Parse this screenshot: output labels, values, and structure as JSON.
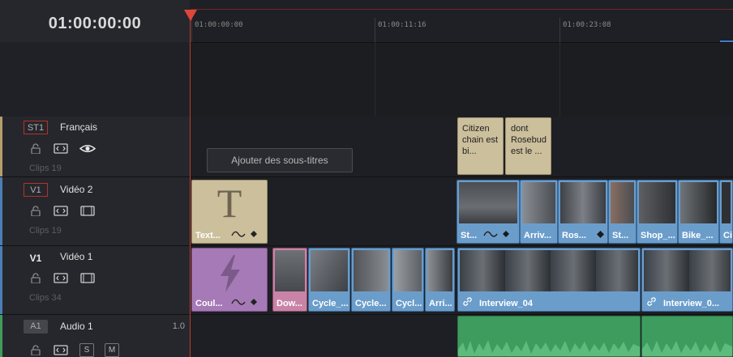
{
  "timecode": "01:00:00:00",
  "ruler": {
    "ticks": [
      "01:00:00:00",
      "01:00:11:16",
      "01:00:23:08"
    ]
  },
  "tracks": {
    "st1": {
      "badge": "ST1",
      "name": "Français",
      "clips": "Clips 19",
      "color": "#b59e6c"
    },
    "v2": {
      "badge": "V1",
      "name": "Vidéo 2",
      "clips": "Clips 19",
      "color": "#4a7fb5"
    },
    "v1": {
      "badge": "V1",
      "name": "Vidéo 1",
      "clips": "Clips 34",
      "color": "#4a7fb5"
    },
    "a1": {
      "badge": "A1",
      "name": "Audio 1",
      "level": "1.0",
      "s": "S",
      "m": "M",
      "color": "#3f9c5c"
    }
  },
  "subtitle_lane": {
    "add_button": "Ajouter des sous-titres",
    "clips": [
      "Citizen chain est bi...",
      "dont Rosebud est le ..."
    ]
  },
  "v2_lane": {
    "title_clip": {
      "glyph": "T",
      "label": "Text..."
    },
    "clips": [
      "St...",
      "Arriv...",
      "Ros...",
      "St...",
      "Shop_...",
      "Bike_...",
      "Cit"
    ]
  },
  "v1_lane": {
    "effect_clip": {
      "label": "Coul..."
    },
    "clips": [
      "Dow...",
      "Cycle_...",
      "Cycle...",
      "Cycl...",
      "Arri...",
      "Interview_04",
      "Interview_0..."
    ]
  }
}
